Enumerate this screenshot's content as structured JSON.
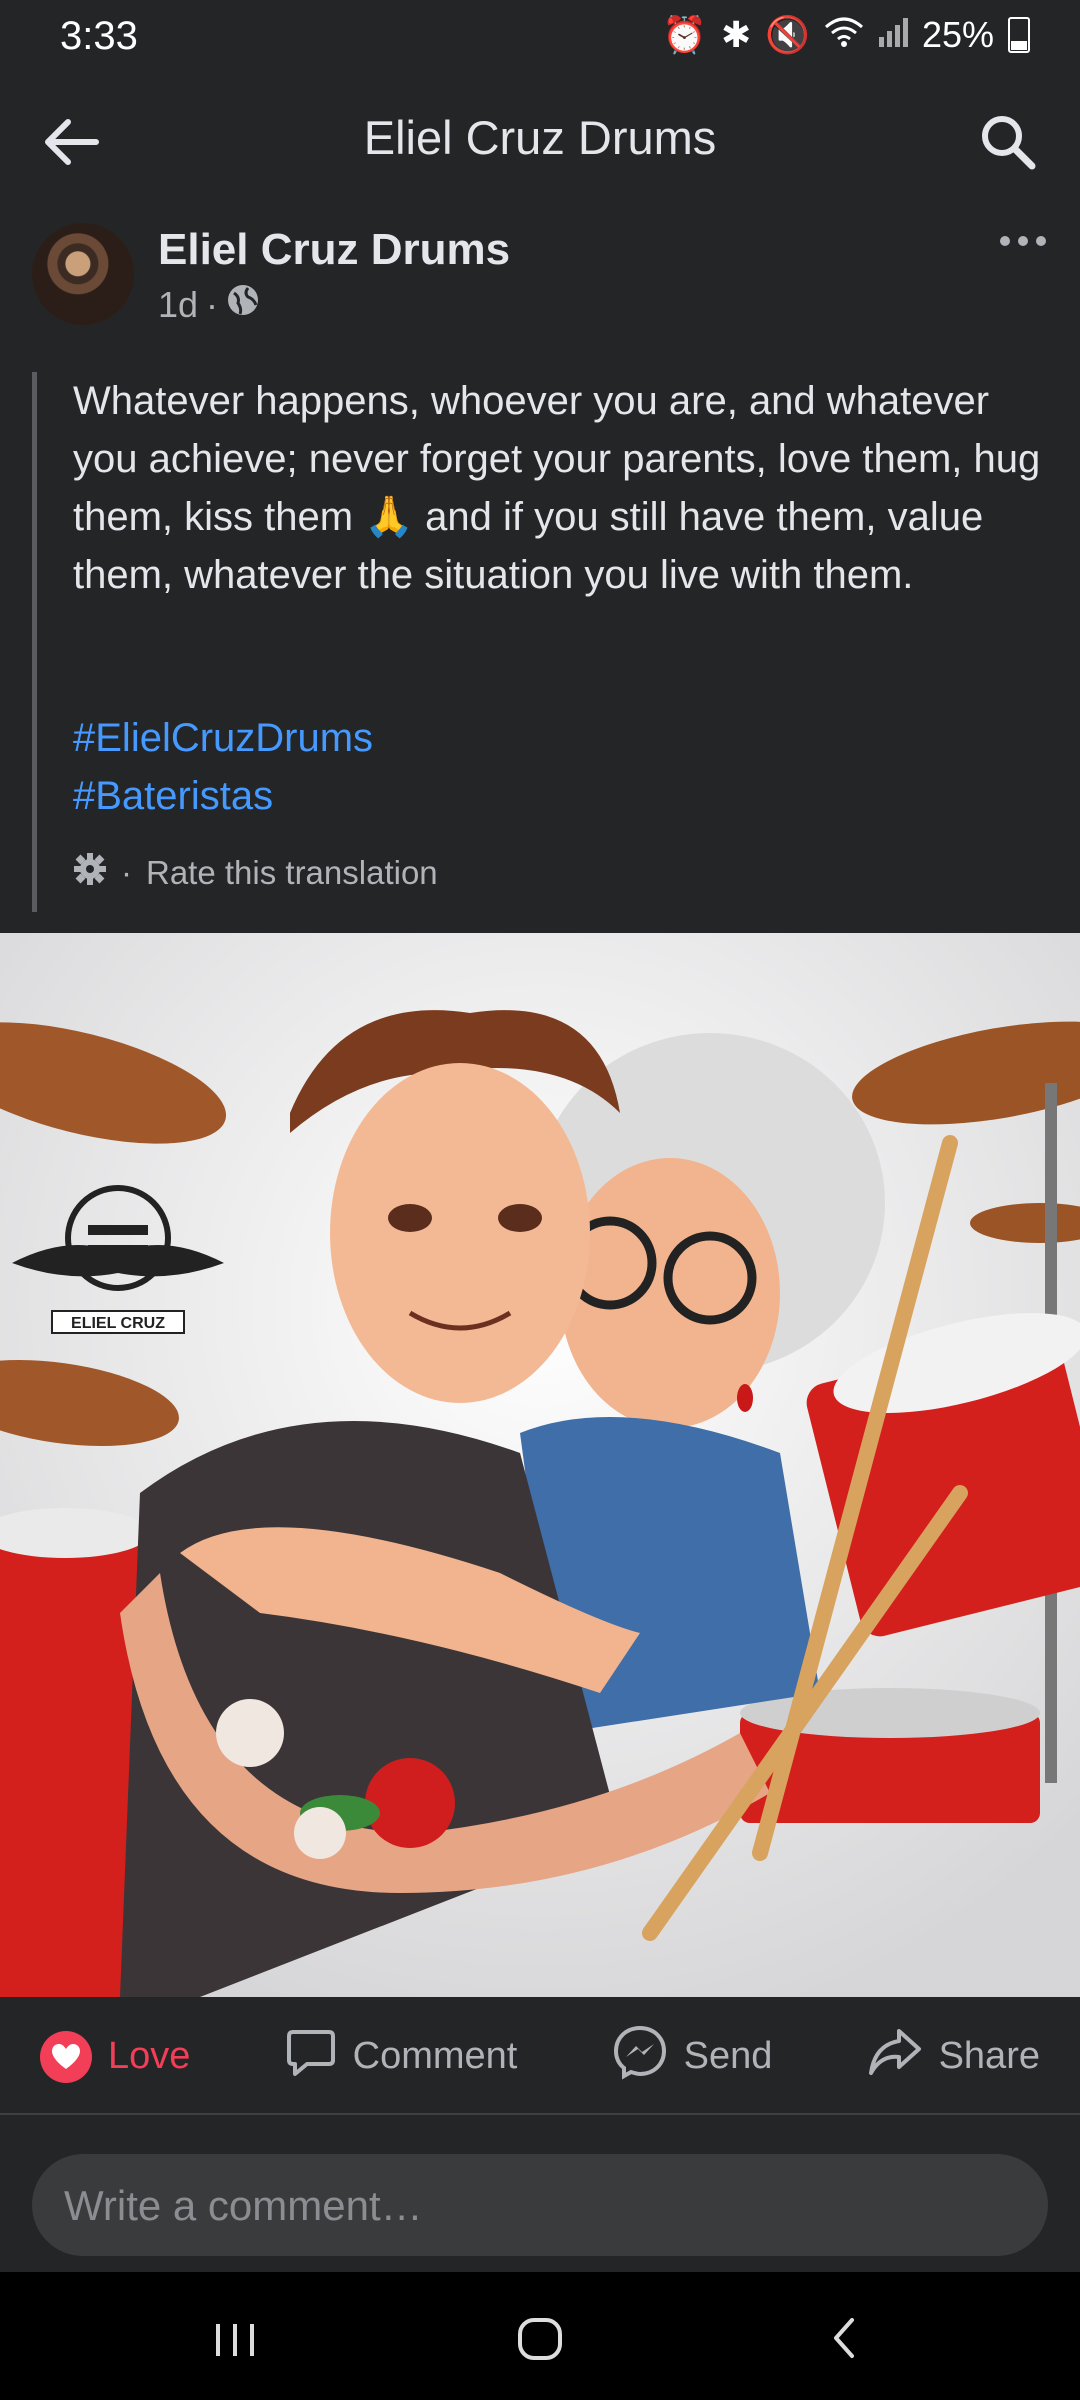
{
  "status_bar": {
    "time": "3:33",
    "battery": "25%"
  },
  "top_bar": {
    "title": "Eliel Cruz Drums"
  },
  "post": {
    "author": "Eliel Cruz Drums",
    "age": "1d",
    "separator": "·",
    "text": "Whatever happens, whoever you are, and whatever you achieve; never forget your parents, love them, hug them, kiss them 🙏 and if you still have them, value them, whatever the situation you live with them.",
    "hashtags": [
      "#ElielCruzDrums",
      "#Bateristas"
    ],
    "rate_dot": "·",
    "rate_translation": "Rate this translation",
    "image_logo_text": "ELIEL CRUZ"
  },
  "actions": {
    "love": "Love",
    "comment": "Comment",
    "send": "Send",
    "share": "Share"
  },
  "comment_box": {
    "placeholder": "Write a comment…"
  },
  "colors": {
    "background": "#242526",
    "love": "#f33e58",
    "hashtag": "#4599ff"
  }
}
